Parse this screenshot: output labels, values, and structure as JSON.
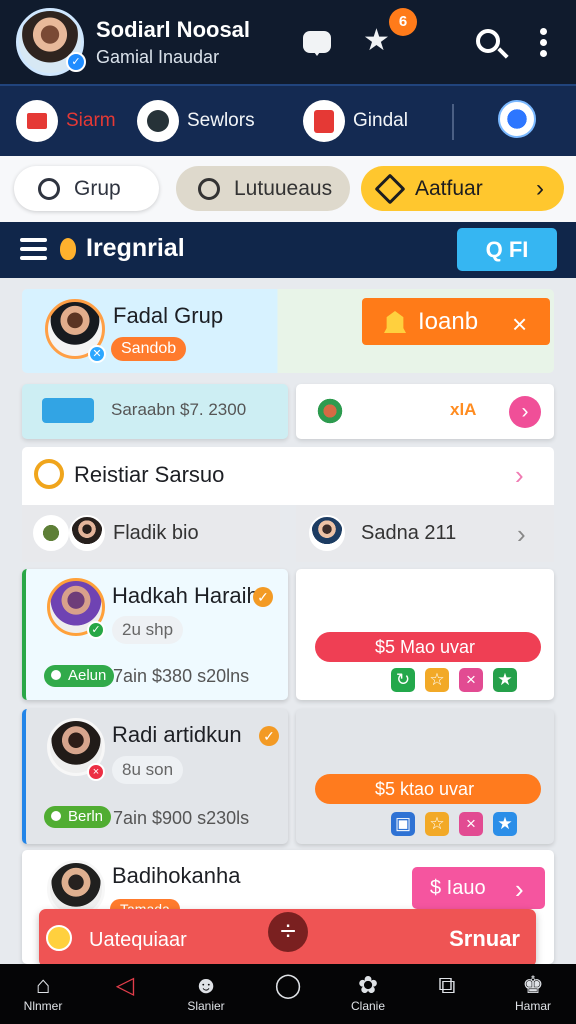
{
  "header": {
    "name": "Sodiarl Noosal",
    "subtitle": "Gamial Inaudar",
    "notification_count": "6"
  },
  "shortcuts": [
    {
      "label": "Siarm",
      "icon": "wallet-icon",
      "color": "#e53935"
    },
    {
      "label": "Sewlors",
      "icon": "shield-icon",
      "color": "#263238"
    },
    {
      "label": "Gindal",
      "icon": "shopping-bag-icon",
      "color": "#e53935"
    }
  ],
  "filters": {
    "group": "Grup",
    "middle": "Lutuueaus",
    "feature": "Aatfuar"
  },
  "section": {
    "title": "Iregnrial",
    "filter_label": "Q FI"
  },
  "hero": {
    "title": "Fadal Grup",
    "badge": "Sandob",
    "action_label": "Ioanb"
  },
  "mini": {
    "left_text": "Saraabn $7. 2300",
    "right_text": "xlA"
  },
  "list": {
    "title": "Reistiar Sarsuo",
    "left_row": "Fladik bio",
    "right_row": "Sadna 211"
  },
  "cards": [
    {
      "name": "Hadkah Haraih",
      "badge": "2u shp",
      "status": "Aelun",
      "price": "7ain $380 s20lns",
      "offer": "$5 Mao uvar"
    },
    {
      "name": "Radi artidkun",
      "badge": "8u son",
      "status": "Berln",
      "price": "7ain $900 s230ls",
      "offer": "$5 ktao uvar"
    }
  ],
  "bottom": {
    "name": "Badihokanha",
    "tag": "Tamada",
    "action": "$ Iauo"
  },
  "toast": {
    "left": "Uatequiaar",
    "right": "Srnuar",
    "center_symbol": "÷"
  },
  "nav": [
    {
      "label": "Nlnmer",
      "icon": "home-icon"
    },
    {
      "label": "",
      "icon": "back-icon"
    },
    {
      "label": "Slanier",
      "icon": "face-icon"
    },
    {
      "label": "",
      "icon": "circle-home-icon"
    },
    {
      "label": "Clanie",
      "icon": "gift-icon"
    },
    {
      "label": "",
      "icon": "copy-icon"
    },
    {
      "label": "Hamar",
      "icon": "user-icon"
    }
  ]
}
